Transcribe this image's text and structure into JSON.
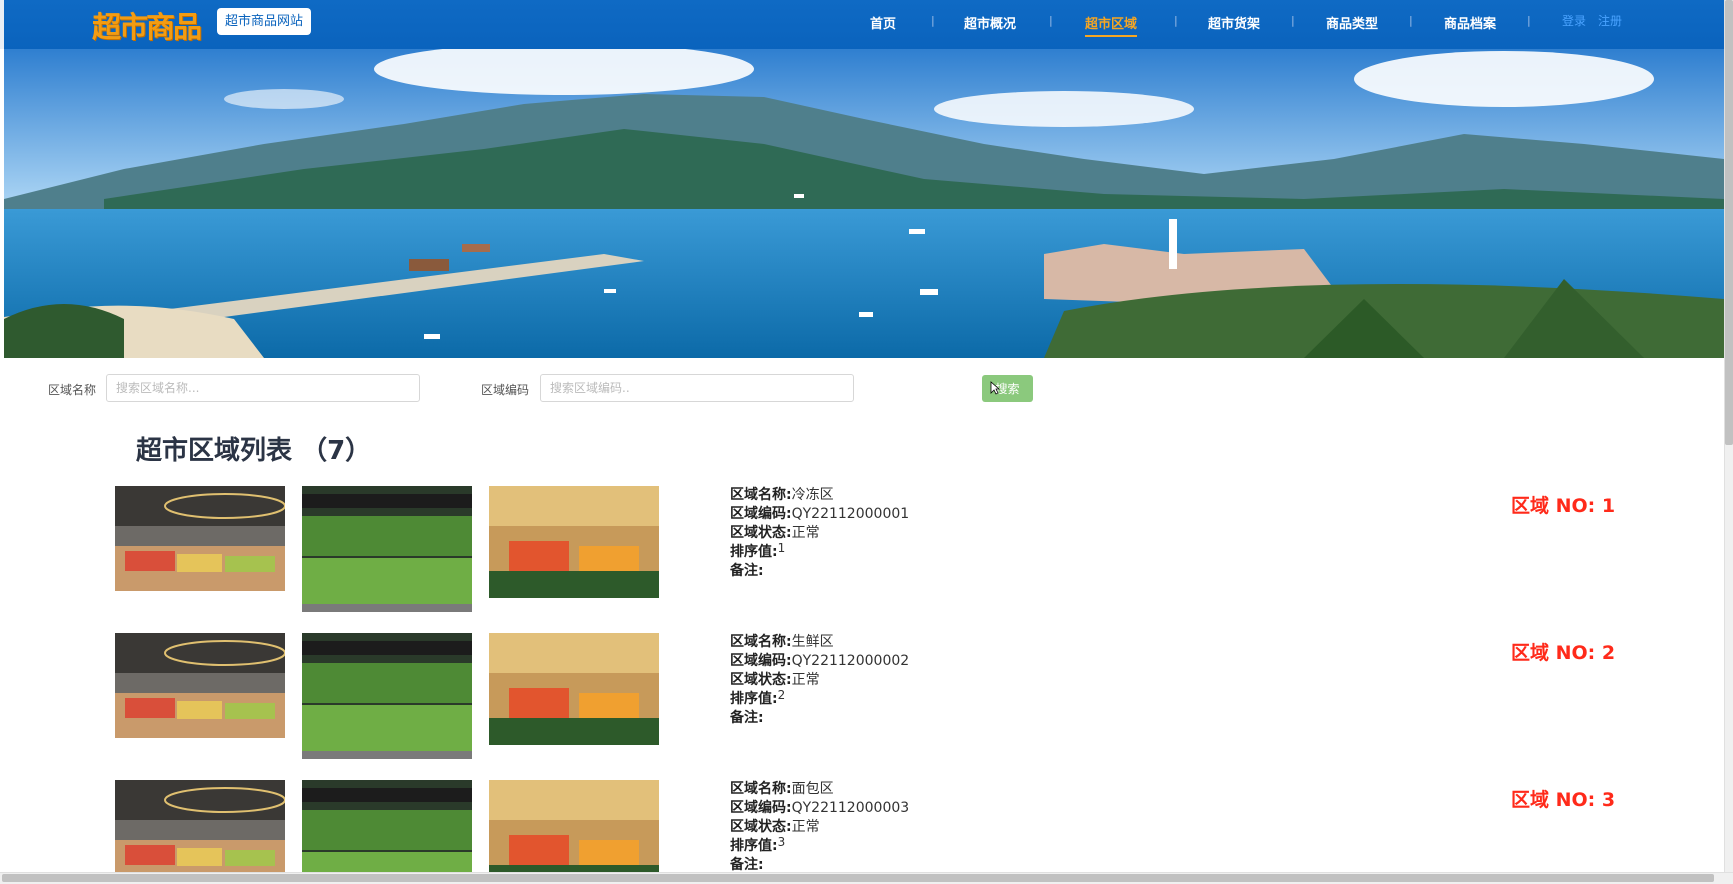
{
  "header": {
    "logo_text": "超市商品",
    "site_badge": "超市商品网站",
    "nav": [
      {
        "label": "首页",
        "active": false
      },
      {
        "label": "超市概况",
        "active": false
      },
      {
        "label": "超市区域",
        "active": true
      },
      {
        "label": "超市货架",
        "active": false
      },
      {
        "label": "商品类型",
        "active": false
      },
      {
        "label": "商品档案",
        "active": false
      }
    ],
    "nav_separator": "|",
    "login": "登录",
    "register": "注册"
  },
  "search": {
    "name_label": "区域名称",
    "name_placeholder": "搜索区域名称...",
    "code_label": "区域编码",
    "code_placeholder": "搜索区域编码..",
    "button_label": "搜索"
  },
  "list": {
    "title": "超市区域列表",
    "count": "（7）",
    "field_labels": {
      "name": "区域名称:",
      "code": "区域编码:",
      "status": "区域状态:",
      "sort": "排序值:",
      "remark": "备注:"
    },
    "items": [
      {
        "no": "区域 NO: 1",
        "name": "冷冻区",
        "code": "QY22112000001",
        "status": "正常",
        "sort": "1",
        "remark": ""
      },
      {
        "no": "区域 NO: 2",
        "name": "生鲜区",
        "code": "QY22112000002",
        "status": "正常",
        "sort": "2",
        "remark": ""
      },
      {
        "no": "区域 NO: 3",
        "name": "面包区",
        "code": "QY22112000003",
        "status": "正常",
        "sort": "3",
        "remark": ""
      }
    ]
  },
  "colors": {
    "header_bg": "#0a63bd",
    "nav_active": "#f5a623",
    "logo": "#f39c12",
    "area_no": "#ff2a1a",
    "search_button": "#8bc97d"
  }
}
